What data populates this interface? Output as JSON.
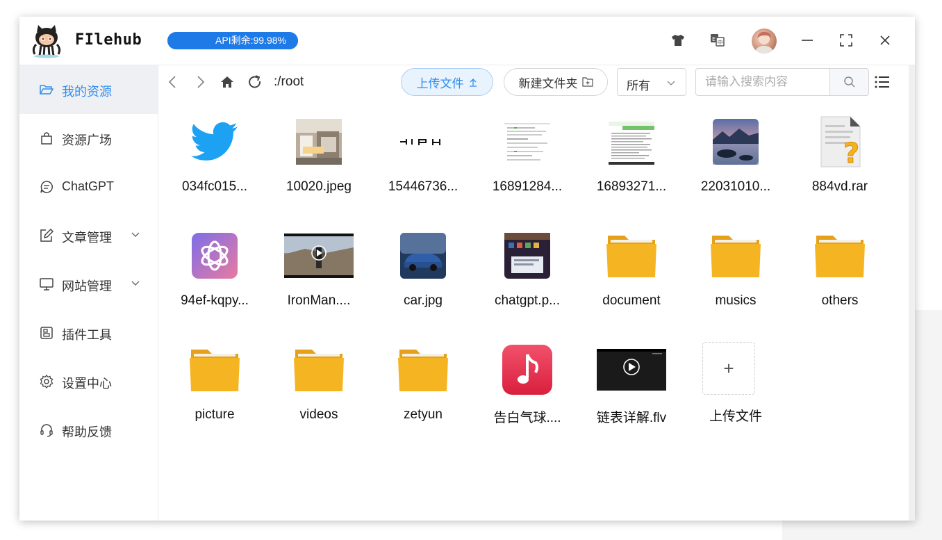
{
  "app": {
    "title": "FIlehub",
    "api_badge": "API剩余:99.98%",
    "api_remaining_percent": 99.98
  },
  "header": {
    "theme_icon": "tshirt-icon",
    "translate_icon": "translate-icon",
    "avatar_icon": "avatar",
    "minimize_icon": "minimize-icon",
    "maximize_icon": "maximize-icon",
    "close_icon": "close-icon"
  },
  "sidebar": {
    "items": [
      {
        "label": "我的资源",
        "icon": "folder-open-icon",
        "active": true
      },
      {
        "label": "资源广场",
        "icon": "shopping-bag-icon"
      },
      {
        "label": "ChatGPT",
        "icon": "chat-bubble-icon"
      },
      {
        "label": "文章管理",
        "icon": "edit-icon",
        "expandable": true
      },
      {
        "label": "网站管理",
        "icon": "monitor-icon",
        "expandable": true
      },
      {
        "label": "插件工具",
        "icon": "plugin-icon"
      },
      {
        "label": "设置中心",
        "icon": "gear-icon"
      },
      {
        "label": "帮助反馈",
        "icon": "headset-icon"
      }
    ]
  },
  "toolbar": {
    "path": ":/root",
    "upload_label": "上传文件",
    "new_folder_label": "新建文件夹",
    "filter_value": "所有",
    "search_placeholder": "请输入搜索内容"
  },
  "files": [
    {
      "name": "034fc015...",
      "kind": "twitter"
    },
    {
      "name": "10020.jpeg",
      "kind": "photo-room"
    },
    {
      "name": "15446736...",
      "kind": "hiph-logo"
    },
    {
      "name": "16891284...",
      "kind": "screenshot-doc"
    },
    {
      "name": "16893271...",
      "kind": "screenshot-doc-green"
    },
    {
      "name": "22031010...",
      "kind": "photo-lake"
    },
    {
      "name": "884vd.rar",
      "kind": "unknown-file"
    },
    {
      "name": "94ef-kqpy...",
      "kind": "openai"
    },
    {
      "name": "IronMan....",
      "kind": "video-ironman"
    },
    {
      "name": "car.jpg",
      "kind": "photo-car"
    },
    {
      "name": "chatgpt.p...",
      "kind": "photo-desktop"
    },
    {
      "name": "document",
      "kind": "folder"
    },
    {
      "name": "musics",
      "kind": "folder"
    },
    {
      "name": "others",
      "kind": "folder"
    },
    {
      "name": "picture",
      "kind": "folder"
    },
    {
      "name": "videos",
      "kind": "folder"
    },
    {
      "name": "zetyun",
      "kind": "folder"
    },
    {
      "name": "告白气球....",
      "kind": "music"
    },
    {
      "name": "链表详解.flv",
      "kind": "video-dark"
    }
  ],
  "upload_tile": {
    "label": "上传文件",
    "symbol": "+"
  },
  "colors": {
    "accent": "#2f8cf0",
    "folder": "#f5b21f",
    "sidebar_active_bg": "#eef0f3"
  }
}
